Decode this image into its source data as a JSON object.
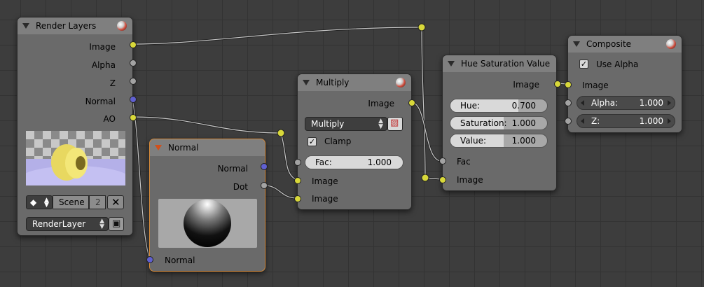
{
  "nodes": {
    "render_layers": {
      "title": "Render Layers",
      "outputs": [
        "Image",
        "Alpha",
        "Z",
        "Normal",
        "AO"
      ],
      "scene": {
        "name": "Scene",
        "users": "2"
      },
      "layer": "RenderLayer"
    },
    "normal": {
      "title": "Normal",
      "outputs": [
        "Normal",
        "Dot"
      ],
      "input": "Normal"
    },
    "multiply": {
      "title": "Multiply",
      "output": "Image",
      "blend_mode": "Multiply",
      "clamp_label": "Clamp",
      "fac": {
        "label": "Fac:",
        "value": "1.000"
      },
      "inputs": [
        "Image",
        "Image"
      ]
    },
    "hue_sat": {
      "title": "Hue Saturation Value",
      "output": "Image",
      "fields": [
        {
          "label": "Hue:",
          "value": "0.700"
        },
        {
          "label": "Saturation:",
          "value": "1.000"
        },
        {
          "label": "Value:",
          "value": "1.000"
        }
      ],
      "inputs": [
        "Fac",
        "Image"
      ]
    },
    "composite": {
      "title": "Composite",
      "use_alpha_label": "Use Alpha",
      "input": "Image",
      "alpha": {
        "label": "Alpha:",
        "value": "1.000"
      },
      "z": {
        "label": "Z:",
        "value": "1.000"
      }
    }
  },
  "colors": {
    "image_socket": "#d8d83a",
    "value_socket": "#a3a3a3",
    "vector_socket": "#6060d0",
    "active_outline": "#d78b3b"
  }
}
